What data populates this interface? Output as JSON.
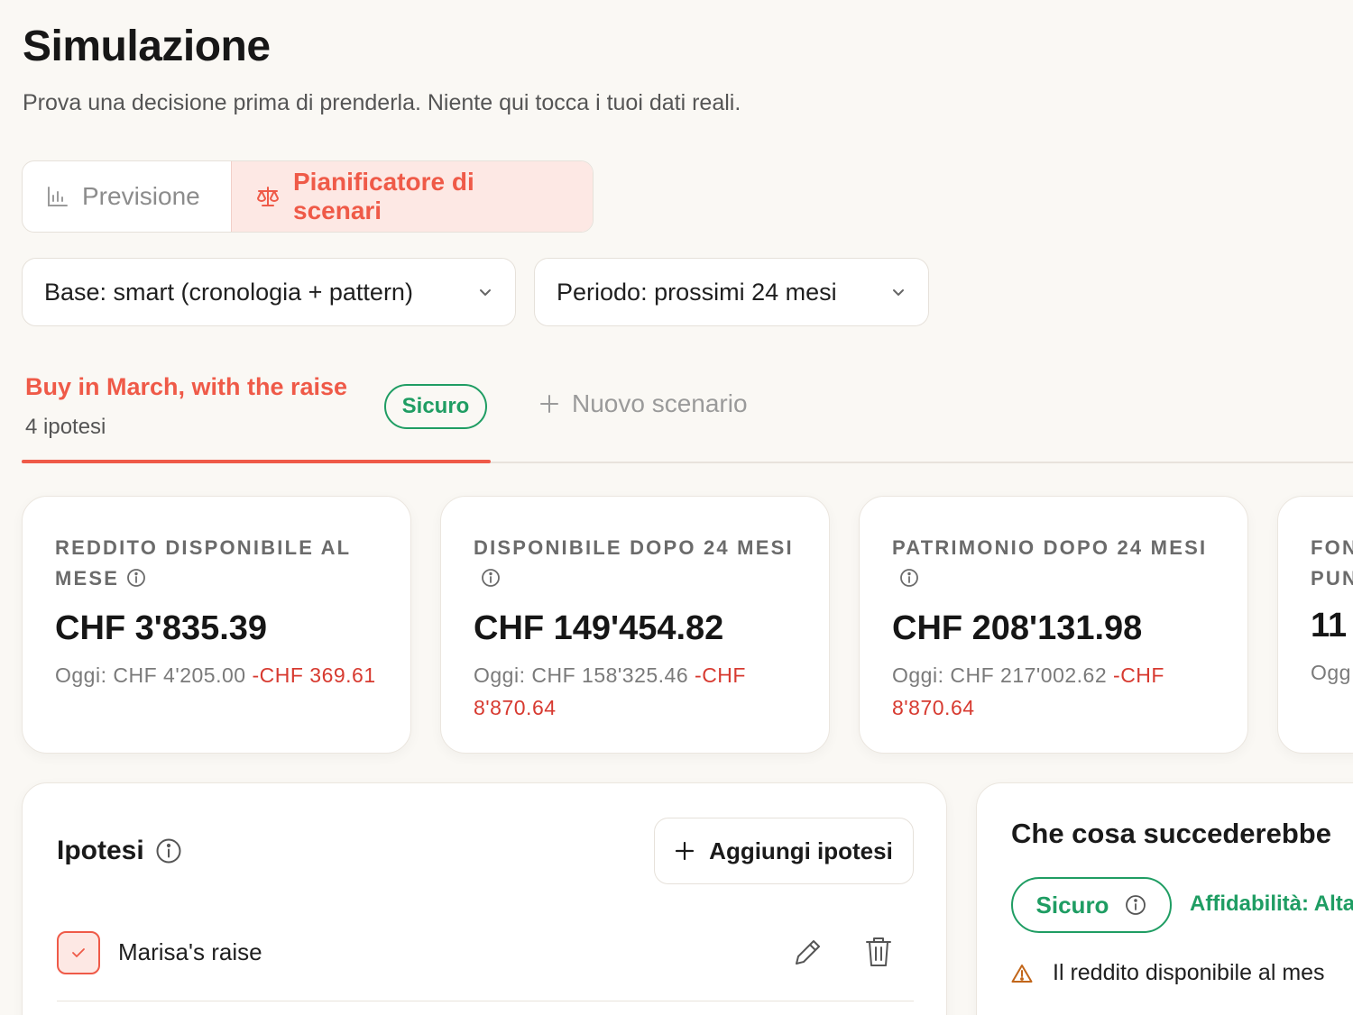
{
  "page": {
    "title": "Simulazione",
    "subtitle": "Prova una decisione prima di prenderla. Niente qui tocca i tuoi dati reali."
  },
  "modes": {
    "forecast_label": "Previsione",
    "planner_label": "Pianificatore di scenari",
    "active": "planner"
  },
  "filters": {
    "base_label": "Base: smart (cronologia + pattern)",
    "period_label": "Periodo: prossimi 24 mesi"
  },
  "scenario_tab": {
    "title": "Buy in March, with the raise",
    "subtitle": "4 ipotesi",
    "badge": "Sicuro",
    "new_label": "Nuovo scenario"
  },
  "kpis": [
    {
      "label": "REDDITO DISPONIBILE AL MESE",
      "value": "CHF 3'835.39",
      "today": "Oggi: CHF 4'205.00",
      "delta": "-CHF 369.61"
    },
    {
      "label": "DISPONIBILE DOPO 24 MESI",
      "value": "CHF 149'454.82",
      "today": "Oggi: CHF 158'325.46",
      "delta": "-CHF 8'870.64"
    },
    {
      "label": "PATRIMONIO DOPO 24 MESI",
      "value": "CHF 208'131.98",
      "today": "Oggi: CHF 217'002.62",
      "delta": "-CHF 8'870.64"
    },
    {
      "label": "FON PUN",
      "value": "11",
      "today": "Ogg",
      "delta": ""
    }
  ],
  "ipotesi": {
    "title": "Ipotesi",
    "add_label": "Aggiungi ipotesi",
    "items": [
      {
        "label": "Marisa's raise",
        "checked": true
      }
    ]
  },
  "what_if": {
    "title": "Che cosa succederebbe",
    "badge": "Sicuro",
    "reliability": "Affidabilità: Alta",
    "warning": "Il reddito disponibile al mes"
  },
  "colors": {
    "accent": "#ef5a48",
    "success": "#1f9d63",
    "negative": "#d73a30",
    "warning": "#c2661a",
    "background": "#faf8f4"
  }
}
